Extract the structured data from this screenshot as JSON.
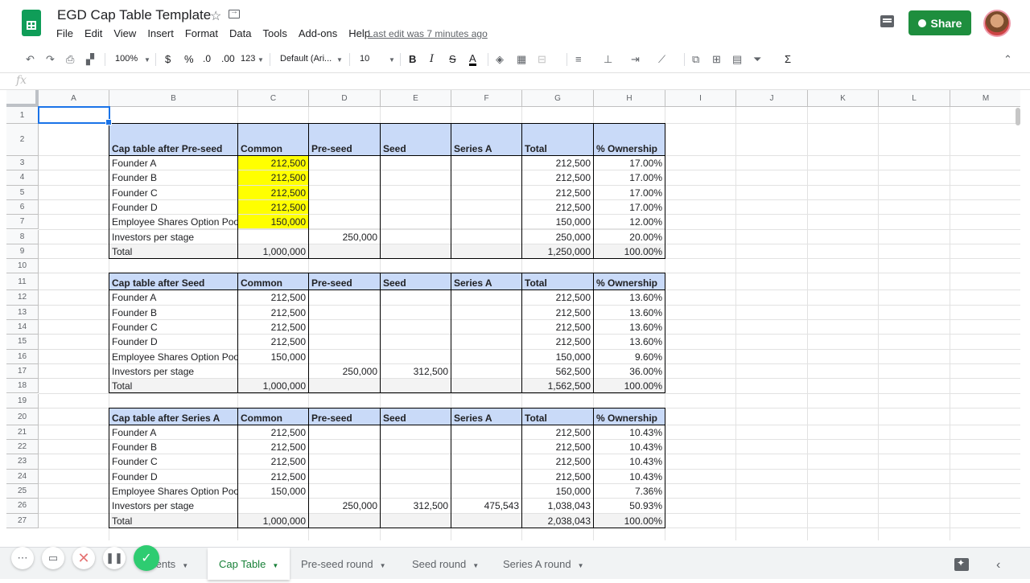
{
  "doc": {
    "title": "EGD Cap Table Template",
    "last_edit": "Last edit was 7 minutes ago",
    "share_label": "Share"
  },
  "menu": [
    "File",
    "Edit",
    "View",
    "Insert",
    "Format",
    "Data",
    "Tools",
    "Add-ons",
    "Help"
  ],
  "toolbar": {
    "zoom": "100%",
    "currency": "$",
    "percent": "%",
    "dec_less": ".0",
    "dec_more": ".00",
    "more_formats": "123",
    "font": "Default (Ari...",
    "font_size": "10",
    "bold": "B",
    "italic": "I",
    "strike": "S",
    "text_color": "A",
    "functions": "Σ"
  },
  "formula_bar": {
    "fx": "fx",
    "value": ""
  },
  "columns": [
    "A",
    "B",
    "C",
    "D",
    "E",
    "F",
    "G",
    "H",
    "I",
    "J",
    "K",
    "L",
    "M"
  ],
  "rows": [
    "1",
    "2",
    "3",
    "4",
    "5",
    "6",
    "7",
    "8",
    "9",
    "10",
    "11",
    "12",
    "13",
    "14",
    "15",
    "16",
    "17",
    "18",
    "19",
    "20",
    "21",
    "22",
    "23",
    "24",
    "25",
    "26",
    "27"
  ],
  "tables": [
    {
      "header": [
        "Cap table after Pre-seed",
        "Common",
        "Pre-seed",
        "Seed",
        "Series A",
        "Total",
        "% Ownership"
      ],
      "rows": [
        [
          "Founder A",
          "212,500",
          "",
          "",
          "",
          "212,500",
          "17.00%"
        ],
        [
          "Founder B",
          "212,500",
          "",
          "",
          "",
          "212,500",
          "17.00%"
        ],
        [
          "Founder C",
          "212,500",
          "",
          "",
          "",
          "212,500",
          "17.00%"
        ],
        [
          "Founder D",
          "212,500",
          "",
          "",
          "",
          "212,500",
          "17.00%"
        ],
        [
          "Employee Shares Option Pool",
          "150,000",
          "",
          "",
          "",
          "150,000",
          "12.00%"
        ],
        [
          "Investors per stage",
          "",
          "250,000",
          "",
          "",
          "250,000",
          "20.00%"
        ],
        [
          "Total",
          "1,000,000",
          "",
          "",
          "",
          "1,250,000",
          "100.00%"
        ]
      ]
    },
    {
      "header": [
        "Cap table after Seed",
        "Common",
        "Pre-seed",
        "Seed",
        "Series A",
        "Total",
        "% Ownership"
      ],
      "rows": [
        [
          "Founder A",
          "212,500",
          "",
          "",
          "",
          "212,500",
          "13.60%"
        ],
        [
          "Founder B",
          "212,500",
          "",
          "",
          "",
          "212,500",
          "13.60%"
        ],
        [
          "Founder C",
          "212,500",
          "",
          "",
          "",
          "212,500",
          "13.60%"
        ],
        [
          "Founder D",
          "212,500",
          "",
          "",
          "",
          "212,500",
          "13.60%"
        ],
        [
          "Employee Shares Option Pool",
          "150,000",
          "",
          "",
          "",
          "150,000",
          "9.60%"
        ],
        [
          "Investors per stage",
          "",
          "250,000",
          "312,500",
          "",
          "562,500",
          "36.00%"
        ],
        [
          "Total",
          "1,000,000",
          "",
          "",
          "",
          "1,562,500",
          "100.00%"
        ]
      ]
    },
    {
      "header": [
        "Cap table after Series A",
        "Common",
        "Pre-seed",
        "Seed",
        "Series A",
        "Total",
        "% Ownership"
      ],
      "rows": [
        [
          "Founder A",
          "212,500",
          "",
          "",
          "",
          "212,500",
          "10.43%"
        ],
        [
          "Founder B",
          "212,500",
          "",
          "",
          "",
          "212,500",
          "10.43%"
        ],
        [
          "Founder C",
          "212,500",
          "",
          "",
          "",
          "212,500",
          "10.43%"
        ],
        [
          "Founder D",
          "212,500",
          "",
          "",
          "",
          "212,500",
          "10.43%"
        ],
        [
          "Employee Shares Option Pool",
          "150,000",
          "",
          "",
          "",
          "150,000",
          "7.36%"
        ],
        [
          "Investors per stage",
          "",
          "250,000",
          "312,500",
          "475,543",
          "1,038,043",
          "50.93%"
        ],
        [
          "Total",
          "1,000,000",
          "",
          "",
          "",
          "2,038,043",
          "100.00%"
        ]
      ]
    }
  ],
  "colors": {
    "header_fill": "#c9daf8",
    "highlight": "#ffff00",
    "total_fill": "#f3f3f3",
    "accent": "#188038"
  },
  "sheet_tabs": [
    {
      "label": "Contents",
      "visible_label": "tents",
      "active": false
    },
    {
      "label": "Cap Table",
      "active": true
    },
    {
      "label": "Pre-seed round",
      "active": false
    },
    {
      "label": "Seed round",
      "active": false
    },
    {
      "label": "Series A round",
      "active": false
    }
  ]
}
